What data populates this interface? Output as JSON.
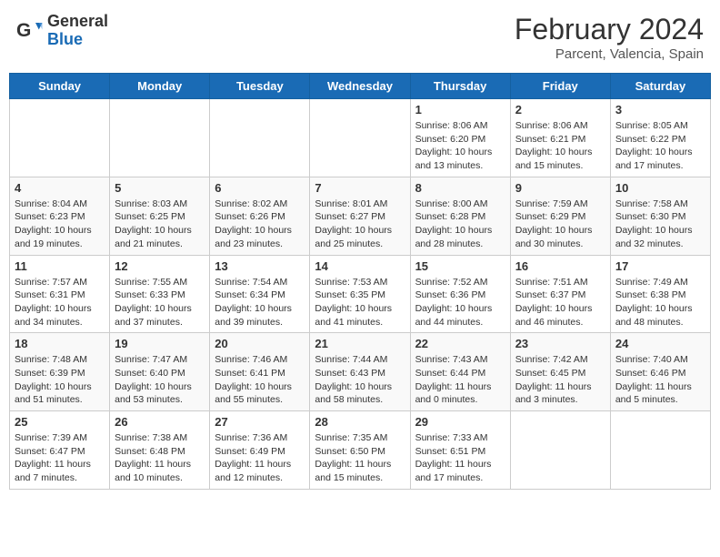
{
  "header": {
    "logo_general": "General",
    "logo_blue": "Blue",
    "month_year": "February 2024",
    "location": "Parcent, Valencia, Spain"
  },
  "days_of_week": [
    "Sunday",
    "Monday",
    "Tuesday",
    "Wednesday",
    "Thursday",
    "Friday",
    "Saturday"
  ],
  "weeks": [
    [
      {
        "day": "",
        "info": ""
      },
      {
        "day": "",
        "info": ""
      },
      {
        "day": "",
        "info": ""
      },
      {
        "day": "",
        "info": ""
      },
      {
        "day": "1",
        "info": "Sunrise: 8:06 AM\nSunset: 6:20 PM\nDaylight: 10 hours and 13 minutes."
      },
      {
        "day": "2",
        "info": "Sunrise: 8:06 AM\nSunset: 6:21 PM\nDaylight: 10 hours and 15 minutes."
      },
      {
        "day": "3",
        "info": "Sunrise: 8:05 AM\nSunset: 6:22 PM\nDaylight: 10 hours and 17 minutes."
      }
    ],
    [
      {
        "day": "4",
        "info": "Sunrise: 8:04 AM\nSunset: 6:23 PM\nDaylight: 10 hours and 19 minutes."
      },
      {
        "day": "5",
        "info": "Sunrise: 8:03 AM\nSunset: 6:25 PM\nDaylight: 10 hours and 21 minutes."
      },
      {
        "day": "6",
        "info": "Sunrise: 8:02 AM\nSunset: 6:26 PM\nDaylight: 10 hours and 23 minutes."
      },
      {
        "day": "7",
        "info": "Sunrise: 8:01 AM\nSunset: 6:27 PM\nDaylight: 10 hours and 25 minutes."
      },
      {
        "day": "8",
        "info": "Sunrise: 8:00 AM\nSunset: 6:28 PM\nDaylight: 10 hours and 28 minutes."
      },
      {
        "day": "9",
        "info": "Sunrise: 7:59 AM\nSunset: 6:29 PM\nDaylight: 10 hours and 30 minutes."
      },
      {
        "day": "10",
        "info": "Sunrise: 7:58 AM\nSunset: 6:30 PM\nDaylight: 10 hours and 32 minutes."
      }
    ],
    [
      {
        "day": "11",
        "info": "Sunrise: 7:57 AM\nSunset: 6:31 PM\nDaylight: 10 hours and 34 minutes."
      },
      {
        "day": "12",
        "info": "Sunrise: 7:55 AM\nSunset: 6:33 PM\nDaylight: 10 hours and 37 minutes."
      },
      {
        "day": "13",
        "info": "Sunrise: 7:54 AM\nSunset: 6:34 PM\nDaylight: 10 hours and 39 minutes."
      },
      {
        "day": "14",
        "info": "Sunrise: 7:53 AM\nSunset: 6:35 PM\nDaylight: 10 hours and 41 minutes."
      },
      {
        "day": "15",
        "info": "Sunrise: 7:52 AM\nSunset: 6:36 PM\nDaylight: 10 hours and 44 minutes."
      },
      {
        "day": "16",
        "info": "Sunrise: 7:51 AM\nSunset: 6:37 PM\nDaylight: 10 hours and 46 minutes."
      },
      {
        "day": "17",
        "info": "Sunrise: 7:49 AM\nSunset: 6:38 PM\nDaylight: 10 hours and 48 minutes."
      }
    ],
    [
      {
        "day": "18",
        "info": "Sunrise: 7:48 AM\nSunset: 6:39 PM\nDaylight: 10 hours and 51 minutes."
      },
      {
        "day": "19",
        "info": "Sunrise: 7:47 AM\nSunset: 6:40 PM\nDaylight: 10 hours and 53 minutes."
      },
      {
        "day": "20",
        "info": "Sunrise: 7:46 AM\nSunset: 6:41 PM\nDaylight: 10 hours and 55 minutes."
      },
      {
        "day": "21",
        "info": "Sunrise: 7:44 AM\nSunset: 6:43 PM\nDaylight: 10 hours and 58 minutes."
      },
      {
        "day": "22",
        "info": "Sunrise: 7:43 AM\nSunset: 6:44 PM\nDaylight: 11 hours and 0 minutes."
      },
      {
        "day": "23",
        "info": "Sunrise: 7:42 AM\nSunset: 6:45 PM\nDaylight: 11 hours and 3 minutes."
      },
      {
        "day": "24",
        "info": "Sunrise: 7:40 AM\nSunset: 6:46 PM\nDaylight: 11 hours and 5 minutes."
      }
    ],
    [
      {
        "day": "25",
        "info": "Sunrise: 7:39 AM\nSunset: 6:47 PM\nDaylight: 11 hours and 7 minutes."
      },
      {
        "day": "26",
        "info": "Sunrise: 7:38 AM\nSunset: 6:48 PM\nDaylight: 11 hours and 10 minutes."
      },
      {
        "day": "27",
        "info": "Sunrise: 7:36 AM\nSunset: 6:49 PM\nDaylight: 11 hours and 12 minutes."
      },
      {
        "day": "28",
        "info": "Sunrise: 7:35 AM\nSunset: 6:50 PM\nDaylight: 11 hours and 15 minutes."
      },
      {
        "day": "29",
        "info": "Sunrise: 7:33 AM\nSunset: 6:51 PM\nDaylight: 11 hours and 17 minutes."
      },
      {
        "day": "",
        "info": ""
      },
      {
        "day": "",
        "info": ""
      }
    ]
  ]
}
